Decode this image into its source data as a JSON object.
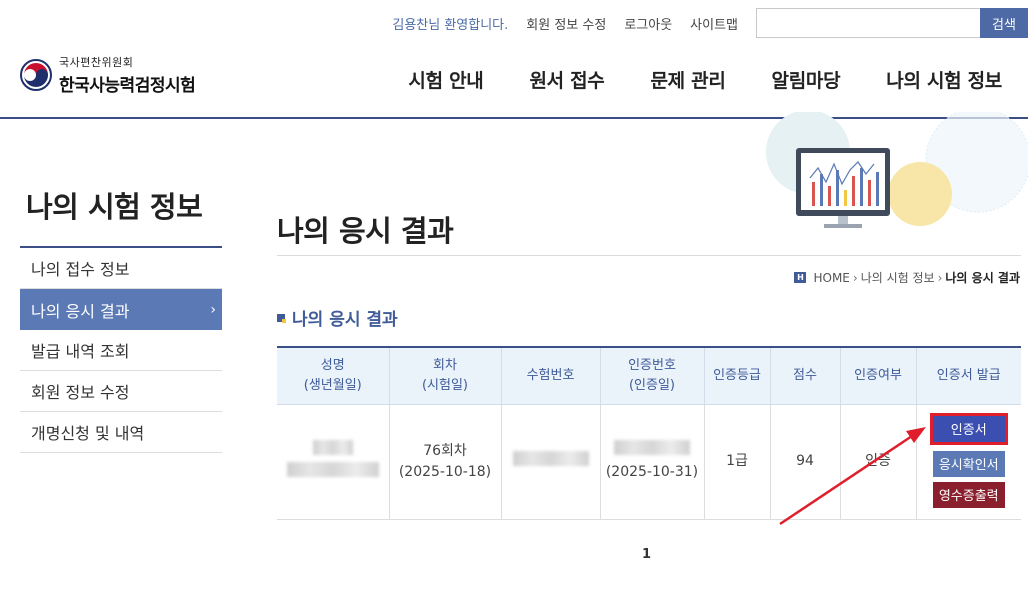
{
  "util": {
    "welcome": "김용찬님 환영합니다.",
    "links": [
      "회원 정보 수정",
      "로그아웃",
      "사이트맵"
    ],
    "search_placeholder": "",
    "search_label": "검색"
  },
  "logo": {
    "sub": "국사편찬위원회",
    "main": "한국사능력검정시험"
  },
  "gnb": [
    "시험 안내",
    "원서 접수",
    "문제 관리",
    "알림마당",
    "나의 시험 정보"
  ],
  "sidebar": {
    "title": "나의 시험 정보",
    "items": [
      {
        "label": "나의 접수 정보"
      },
      {
        "label": "나의 응시 결과",
        "active": true
      },
      {
        "label": "발급 내역 조회"
      },
      {
        "label": "회원 정보 수정"
      },
      {
        "label": "개명신청 및 내역"
      }
    ]
  },
  "page": {
    "title": "나의 응시 결과",
    "breadcrumb": [
      "HOME",
      "나의 시험 정보",
      "나의 응시 결과"
    ],
    "section_title": "나의 응시 결과"
  },
  "table": {
    "headers": [
      [
        "성명",
        "(생년월일)"
      ],
      [
        "회차",
        "(시험일)"
      ],
      [
        "수험번호"
      ],
      [
        "인증번호",
        "(인증일)"
      ],
      [
        "인증등급"
      ],
      [
        "점수"
      ],
      [
        "인증여부"
      ],
      [
        "인증서 발급"
      ]
    ],
    "row": {
      "round": "76회차",
      "exam_date": "(2025-10-18)",
      "cert_date": "(2025-10-31)",
      "grade": "1급",
      "score": "94",
      "status": "인증"
    },
    "buttons": {
      "cert": "인증서",
      "confirm": "응시확인서",
      "receipt": "영수증출력"
    }
  },
  "pager": {
    "current": "1"
  },
  "colors": {
    "primary": "#3b4f86",
    "accent": "#5a79b5",
    "header_bg": "#eaf2fa",
    "highlight": "#e01e2b",
    "receipt": "#8a1f2e"
  }
}
